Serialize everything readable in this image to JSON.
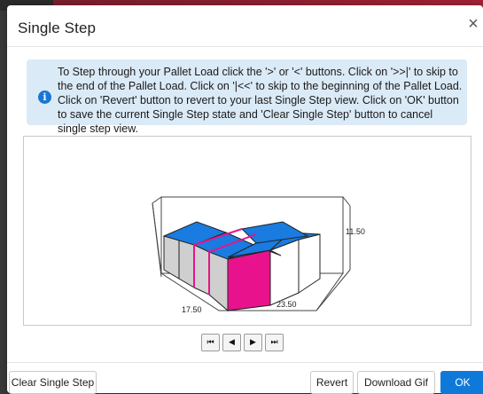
{
  "dialog": {
    "title": "Single Step",
    "close_glyph": "×",
    "info_icon_glyph": "i",
    "info_text": "To Step through your Pallet Load click the '>' or '<' buttons. Click on '>>|' to skip to the end of the Pallet Load. Click on '|<<' to skip to the beginning of the Pallet Load. Click on 'Revert' button to revert to your last Single Step view. Click on 'OK' button to save the current Single Step state and 'Clear Single Step' button to cancel single step view."
  },
  "viewer": {
    "dim_length": "23.50",
    "dim_width": "17.50",
    "dim_height": "11.50",
    "colors": {
      "top": "#1a7be0",
      "side": "#d4d4d4",
      "highlight": "#e8138c",
      "edge": "#222222"
    }
  },
  "nav": {
    "first": "⏮",
    "prev": "◀",
    "next": "▶",
    "last": "⏭"
  },
  "footer": {
    "clear_label": "Clear Single Step",
    "revert_label": "Revert",
    "download_label": "Download Gif",
    "ok_label": "OK"
  }
}
